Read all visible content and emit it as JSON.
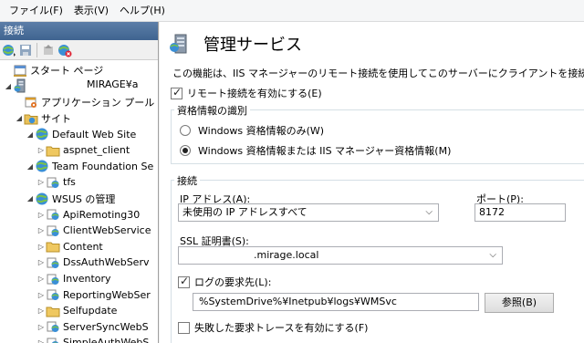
{
  "menu": [
    "ファイル(F)",
    "表示(V)",
    "ヘルプ(H)"
  ],
  "left": {
    "header": "接続",
    "tree": [
      {
        "label": "スタート ページ",
        "indent": 0,
        "exp": "",
        "icon": "start-page-icon"
      },
      {
        "label": "MIRAGE¥a",
        "indent": 0,
        "exp": "◢",
        "icon": "server-icon"
      },
      {
        "label": "アプリケーション プール",
        "indent": 1,
        "exp": "",
        "icon": "app-pool-icon"
      },
      {
        "label": "サイト",
        "indent": 1,
        "exp": "◢",
        "icon": "sites-folder-icon"
      },
      {
        "label": "Default Web Site",
        "indent": 2,
        "exp": "◢",
        "icon": "globe-icon"
      },
      {
        "label": "aspnet_client",
        "indent": 3,
        "exp": "▷",
        "icon": "folder-icon"
      },
      {
        "label": "Team Foundation Se",
        "indent": 2,
        "exp": "◢",
        "icon": "globe-icon"
      },
      {
        "label": "tfs",
        "indent": 3,
        "exp": "▷",
        "icon": "app-icon"
      },
      {
        "label": "WSUS の管理",
        "indent": 2,
        "exp": "◢",
        "icon": "globe-icon"
      },
      {
        "label": "ApiRemoting30",
        "indent": 3,
        "exp": "▷",
        "icon": "app-icon"
      },
      {
        "label": "ClientWebService",
        "indent": 3,
        "exp": "▷",
        "icon": "app-icon"
      },
      {
        "label": "Content",
        "indent": 3,
        "exp": "▷",
        "icon": "folder-icon"
      },
      {
        "label": "DssAuthWebServ",
        "indent": 3,
        "exp": "▷",
        "icon": "app-icon"
      },
      {
        "label": "Inventory",
        "indent": 3,
        "exp": "▷",
        "icon": "app-icon"
      },
      {
        "label": "ReportingWebSer",
        "indent": 3,
        "exp": "▷",
        "icon": "app-icon"
      },
      {
        "label": "Selfupdate",
        "indent": 3,
        "exp": "▷",
        "icon": "folder-icon"
      },
      {
        "label": "ServerSyncWebS",
        "indent": 3,
        "exp": "▷",
        "icon": "app-icon"
      },
      {
        "label": "SimpleAuthWebS",
        "indent": 3,
        "exp": "▷",
        "icon": "app-icon"
      }
    ]
  },
  "right": {
    "title": "管理サービス",
    "description": "この機能は、IIS マネージャーのリモート接続を使用してこのサーバーにクライアントを接続する方法を構成する場合",
    "enable_remote": "リモート接続を有効にする(E)",
    "credentials_group": "資格情報の識別",
    "radio_windows_only": "Windows 資格情報のみ(W)",
    "radio_windows_or_iis": "Windows 資格情報または IIS マネージャー資格情報(M)",
    "connection_group": "接続",
    "ip_label": "IP アドレス(A):",
    "ip_value": "未使用の IP アドレスすべて",
    "port_label": "ポート(P):",
    "port_value": "8172",
    "ssl_label": "SSL 証明書(S):",
    "ssl_value": ".mirage.local",
    "log_label": "ログの要求先(L):",
    "log_path": "%SystemDrive%¥Inetpub¥logs¥WMSvc",
    "browse_button": "参照(B)",
    "failed_trace": "失敗した要求トレースを有効にする(F)"
  }
}
